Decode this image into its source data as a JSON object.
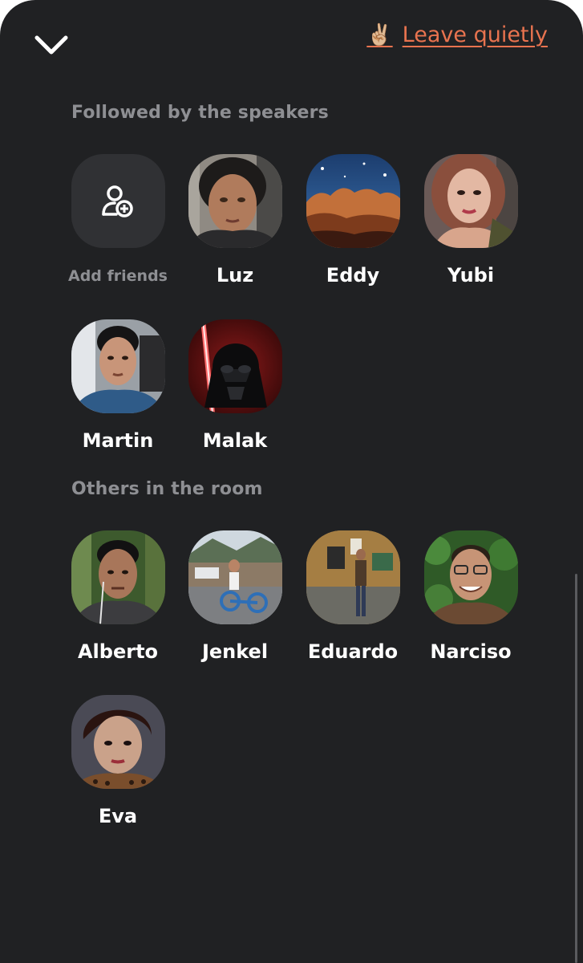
{
  "header": {
    "leave_emoji": "✌🏼",
    "leave_label": "Leave quietly"
  },
  "followed": {
    "title": "Followed by the speakers",
    "add_label": "Add friends",
    "people": [
      {
        "name": "Luz"
      },
      {
        "name": "Eddy"
      },
      {
        "name": "Yubi"
      },
      {
        "name": "Martin"
      },
      {
        "name": "Malak"
      }
    ]
  },
  "others": {
    "title": "Others in the room",
    "people": [
      {
        "name": "Alberto"
      },
      {
        "name": "Jenkel"
      },
      {
        "name": "Eduardo"
      },
      {
        "name": "Narciso"
      },
      {
        "name": "Eva"
      }
    ]
  },
  "colors": {
    "background": "#202123",
    "accent": "#e8734f",
    "muted_text": "#8e8f93",
    "tile": "#303134"
  }
}
